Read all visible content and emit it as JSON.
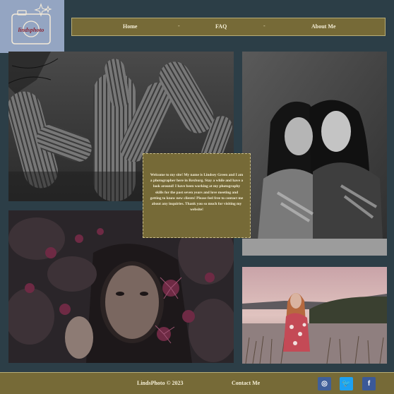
{
  "logo": {
    "text": "lindsphoto"
  },
  "nav": {
    "items": [
      {
        "label": "Home"
      },
      {
        "label": "FAQ"
      },
      {
        "label": "About Me"
      }
    ],
    "separator": "-"
  },
  "photos": {
    "cactus": {
      "icon": "saguaro-cactus-photo"
    },
    "two_girls": {
      "icon": "two-women-portrait-photo"
    },
    "flowers": {
      "icon": "woman-behind-flowers-photo"
    },
    "field": {
      "icon": "woman-in-field-photo"
    }
  },
  "welcome": {
    "text": "Welcome to my site! My name is Lindsey Green and I am a photographer here in Rexburg. Stay a while and have a look around! I have been working at my photography skills for the past seven years and love meeting and getting to know new clients! Please feel free to contact me about any inquiries. Thank you so much for visiting my website!"
  },
  "footer": {
    "copyright": "LindsPhoto © 2023",
    "contact": "Contact Me",
    "social": [
      {
        "icon": "instagram-icon",
        "glyph": "◎",
        "color": "#3f5f9a"
      },
      {
        "icon": "twitter-icon",
        "glyph": "🐦",
        "color": "#1da1f2"
      },
      {
        "icon": "facebook-icon",
        "glyph": "f",
        "color": "#3b5998"
      }
    ]
  }
}
